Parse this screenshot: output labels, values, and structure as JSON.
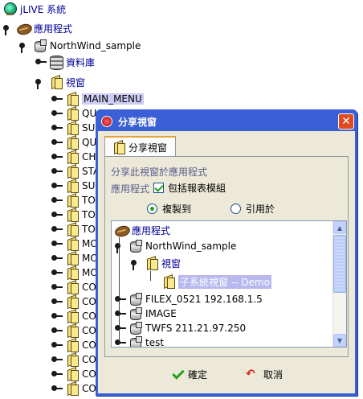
{
  "tree": {
    "root": "jLIVE 系統",
    "app": "應用程式",
    "project": "NorthWind_sample",
    "database": "資料庫",
    "views": "視窗",
    "items": [
      "MAIN_MENU",
      "QU",
      "SUE",
      "QU",
      "CHA",
      "STA",
      "SUE",
      "TOF",
      "TOF",
      "TOF",
      "MO",
      "MO",
      "MO",
      "CO",
      "CO",
      "CO",
      "CO",
      "CO",
      "CO",
      "CO",
      "CO"
    ]
  },
  "dialog": {
    "title": "分享視窗",
    "close_glyph": "✕",
    "tab": "分享視窗",
    "caption": "分享此視窗於應用程式",
    "app_label": "應用程式",
    "checkbox_label": "包括報表模組",
    "radio_copy": "複製到",
    "radio_ref": "引用於",
    "target_tree": {
      "app": "應用程式",
      "project": "NorthWind_sample",
      "views": "視窗",
      "selected": "子系統視窗 -- Demo",
      "others": [
        "FILEX_0521  192.168.1.5",
        "IMAGE",
        "TWFS  211.21.97.250",
        "test"
      ]
    },
    "ok": "確定",
    "cancel": "取消"
  },
  "colors": {
    "titlebar": "#3a5fd6",
    "selection": "#ccccf5",
    "label_blue": "#000099"
  }
}
